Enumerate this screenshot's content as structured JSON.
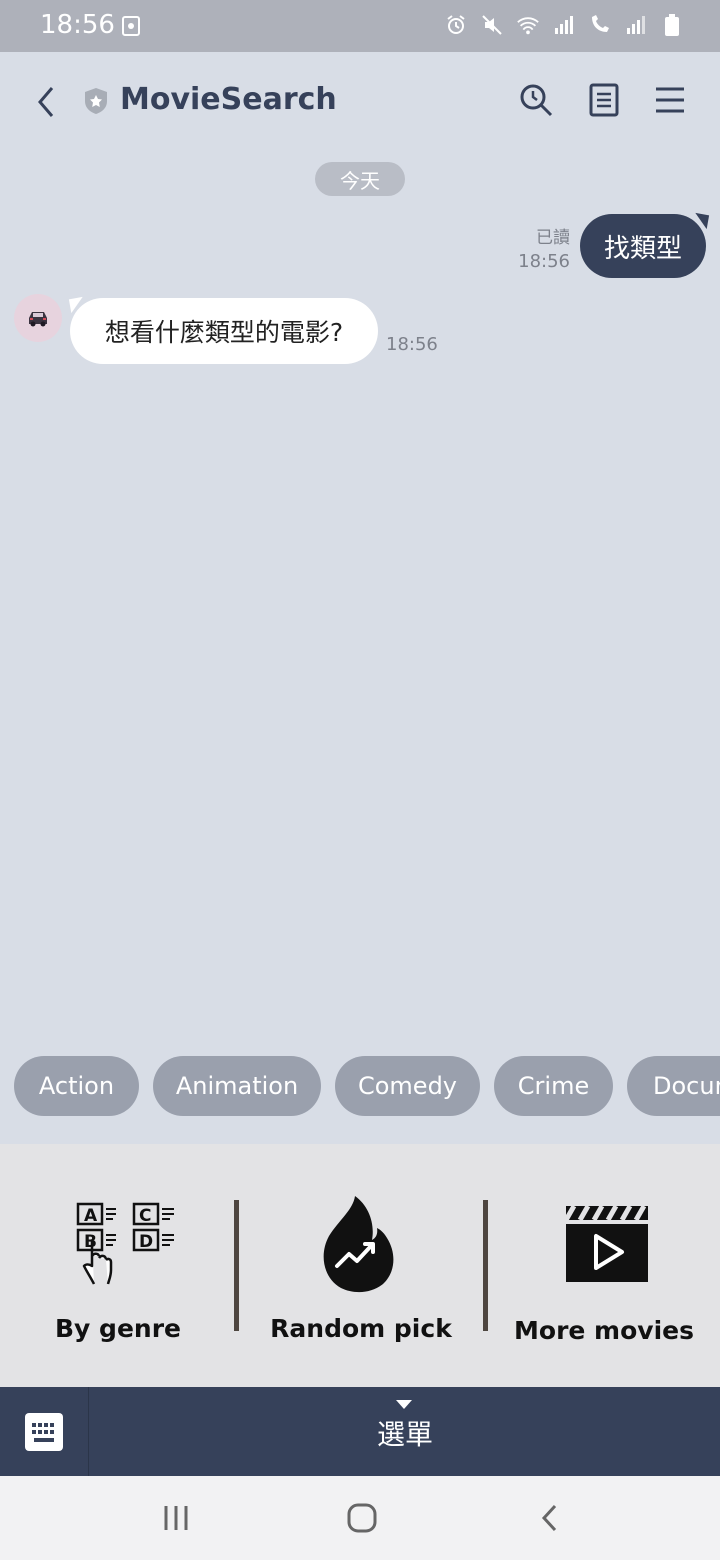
{
  "status_bar": {
    "time": "18:56"
  },
  "header": {
    "title": "MovieSearch"
  },
  "chat": {
    "date_divider": "今天",
    "outgoing": {
      "text": "找類型",
      "read_label": "已讀",
      "time": "18:56"
    },
    "incoming": {
      "text": "想看什麼類型的電影?",
      "time": "18:56"
    }
  },
  "quick_replies": [
    "Action",
    "Animation",
    "Comedy",
    "Crime",
    "Documentary"
  ],
  "rich_menu": {
    "items": [
      {
        "label": "By  genre",
        "icon": "genre-letter-grid-icon"
      },
      {
        "label": "Random pick",
        "icon": "flame-trend-icon"
      },
      {
        "label": "More movies",
        "icon": "clapperboard-play-icon"
      }
    ]
  },
  "menu_bar": {
    "label": "選單"
  },
  "colors": {
    "accent": "#36415a",
    "chat_bg": "#d8dde6",
    "chip": "#9aa0ad",
    "rich_menu_bg": "#e3e3e5"
  }
}
